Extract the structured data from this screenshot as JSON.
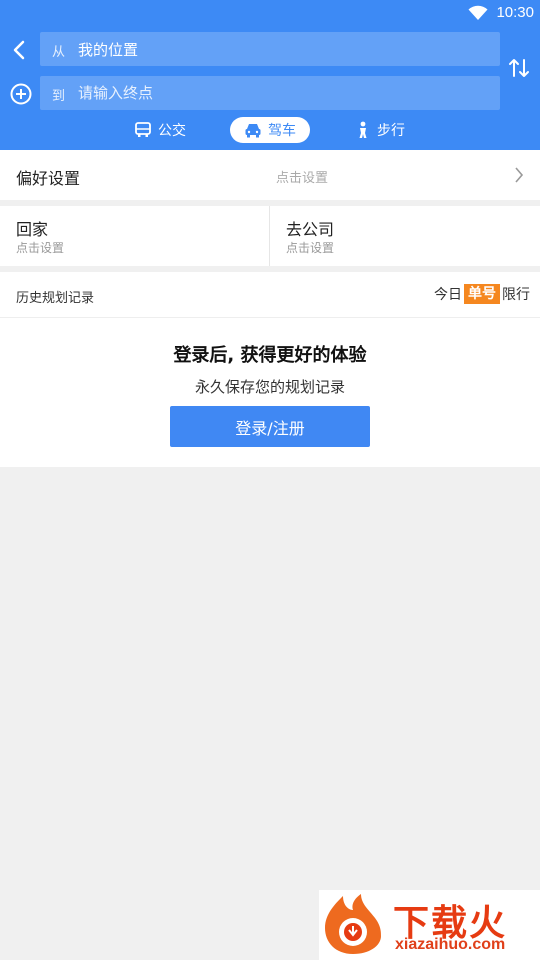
{
  "status": {
    "time": "10:30"
  },
  "route": {
    "from_prefix": "从",
    "from_value": "我的位置",
    "to_prefix": "到",
    "to_placeholder": "请输入终点",
    "to_value": ""
  },
  "modes": [
    {
      "label": "公交",
      "icon": "bus-icon"
    },
    {
      "label": "驾车",
      "icon": "car-icon",
      "selected": true
    },
    {
      "label": "步行",
      "icon": "walk-icon"
    }
  ],
  "preferences": {
    "label": "偏好设置",
    "hint": "点击设置"
  },
  "shortcuts": [
    {
      "title": "回家",
      "hint": "点击设置"
    },
    {
      "title": "去公司",
      "hint": "点击设置"
    }
  ],
  "history": {
    "title": "历史规划记录",
    "restriction_prefix": "今日",
    "restriction_badge": "单号",
    "restriction_suffix": "限行"
  },
  "login": {
    "title": "登录后, 获得更好的体验",
    "subtitle": "永久保存您的规划记录",
    "button": "登录/注册"
  },
  "watermark": {
    "text": "下载火",
    "url": "xiazaihuo.com"
  },
  "colors": {
    "primary": "#3d8af5",
    "badge": "#f5871f",
    "watermark": "#e63b12"
  }
}
